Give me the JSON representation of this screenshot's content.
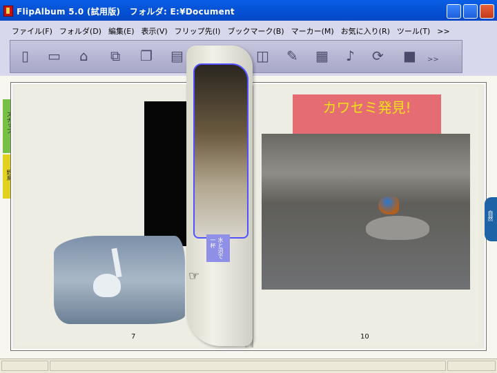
{
  "window": {
    "title": "FlipAlbum 5.0 (試用版)   フォルダ: E:¥Document",
    "accent": "#0552d6"
  },
  "menubar": {
    "items": [
      "ファイル(F)",
      "フォルダ(D)",
      "編集(E)",
      "表示(V)",
      "フリップ先(I)",
      "ブックマーク(B)",
      "マーカー(M)",
      "お気に入り(R)",
      "ツール(T)",
      ">>"
    ]
  },
  "toolbar": {
    "icons": [
      "page-icon",
      "open-book-icon",
      "folder-icon",
      "refresh-page-icon",
      "copy-icon",
      "paste-icon",
      "text-icon",
      "flip-icon",
      "pencil-icon",
      "grid-icon",
      "music-icon",
      "rotate-icon",
      "camera-icon"
    ],
    "more_label": ">>"
  },
  "left_tabs": [
    {
      "label": "スナップ",
      "color": "#76c043"
    },
    {
      "label": "野鳥",
      "color": "#e3d21c"
    }
  ],
  "right_tab": {
    "label": "自然",
    "color": "#1d63a6"
  },
  "page_left": {
    "page_number": "7"
  },
  "page_right": {
    "headline": "カワセミ発見!",
    "headline_bg": "#e46c72",
    "headline_color": "#f2e219",
    "page_number": "10"
  },
  "curling_page": {
    "sticker_text": "水と沼で一杯"
  },
  "statusbar": {
    "fields": [
      "",
      "",
      ""
    ]
  }
}
